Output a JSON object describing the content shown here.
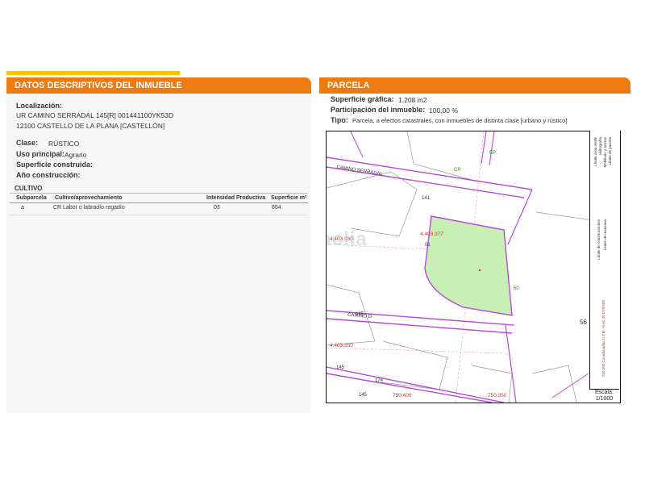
{
  "left_panel": {
    "header": "DATOS DESCRIPTIVOS DEL INMUEBLE",
    "localizacion_label": "Localización:",
    "address_line1": "UR CAMINO SERRADAL 145[R] 001441100YK53D",
    "address_line2": "12100 CASTELLO DE LA PLANA [CASTELLÓN]",
    "clase_label": "Clase:",
    "clase_value": "RÚSTICO",
    "uso_label": "Uso principal:",
    "uso_value": "Agrario",
    "superficie_label": "Superficie construida:",
    "anio_label": "Año construcción:",
    "cultivo": {
      "title": "CULTIVO",
      "headers": [
        "Subparcela",
        "Cultivo/aprovechamiento",
        "Intensidad Productiva",
        "Superficie m²"
      ],
      "rows": [
        {
          "subparcela": "a",
          "cultivo": "CR Labor o labradío regadío",
          "intensidad": "03",
          "superficie": "854"
        }
      ]
    }
  },
  "right_panel": {
    "header": "PARCELA",
    "superficie_label": "Superficie gráfica:",
    "superficie_value": "1.208 m2",
    "participacion_label": "Participación del inmueble:",
    "participacion_value": "100,00 %",
    "tipo_label": "Tipo:",
    "tipo_value": "Parcela, a efectos catastrales, con inmuebles de distinta clase [urbano y rústico]"
  },
  "map": {
    "labels": {
      "camino_serradal": "CAMINO SERRADAL",
      "n141": "141",
      "n145_a": "145",
      "n145_b": "145",
      "n145_c": "145",
      "n174": "174",
      "n60": "60",
      "n01": "01",
      "n56": "56",
      "ep": "EP",
      "cr": "CR",
      "camino_d": "CAMINO D",
      "coord_1": "4.403.930",
      "coord_2": "4.403.850",
      "coord_3": "4.403.377",
      "coord_4": "750.400",
      "coord_5": "750.350"
    },
    "watermark": "habitaclia",
    "legend": {
      "item1": "Límite de manzana",
      "item2": "Límite de parcela",
      "item3": "Límite de construcciones",
      "item4": "Mobiliario y aceras",
      "item5": "Hidrografía",
      "item6": "Límite zona verde",
      "coords_note": "750.500 Coordenadas U.T.M. Huso 30 ETRS89"
    },
    "scale_label": "Escala:",
    "scale_value": "1/1000",
    "colors": {
      "parcel_fill": "#c8f0b4",
      "boundary": "#b74bd6",
      "accent": "#ee7a12"
    }
  }
}
